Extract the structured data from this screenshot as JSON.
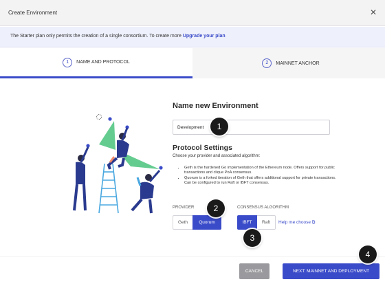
{
  "header": {
    "title": "Create Environment",
    "close_icon": "close-icon"
  },
  "banner": {
    "text": "The Starter plan only permits the creation of a single consortium. To create more",
    "link": "Upgrade your plan"
  },
  "tabs": [
    {
      "number": "1",
      "label": "NAME AND PROTOCOL",
      "active": true
    },
    {
      "number": "2",
      "label": "MAINNET ANCHOR",
      "active": false
    }
  ],
  "form": {
    "name_heading": "Name new Environment",
    "name_value": "Development",
    "protocol_heading": "Protocol Settings",
    "protocol_sub": "Choose your provider and associated algorithm:",
    "bullets": [
      "Geth is the hardened Go implementation of the Ethereum node. Offers support for public transactions and clique PoA consensus.",
      "Quorum is a forked iteration of Geth that offers additional support for private transactions. Can be configured to run Raft or IBFT consensus."
    ],
    "provider_label": "PROVIDER",
    "provider_options": [
      "Geth",
      "Quorum"
    ],
    "provider_selected": "Quorum",
    "consensus_label": "CONSENSUS ALGORITHM",
    "consensus_options": [
      "IBFT",
      "Raft"
    ],
    "consensus_selected": "IBFT",
    "help_link": "Help me choose",
    "help_icon": "external-link-icon"
  },
  "footer": {
    "cancel_label": "CANCEL",
    "next_label": "NEXT: MAINNET AND DEPLOYMENT"
  },
  "markers": [
    "1",
    "2",
    "3",
    "4"
  ],
  "colors": {
    "accent": "#3a4bc9",
    "cancel": "#9a9a9e",
    "banner_bg": "#eef0fb",
    "illustration_green": "#5dc98a"
  }
}
